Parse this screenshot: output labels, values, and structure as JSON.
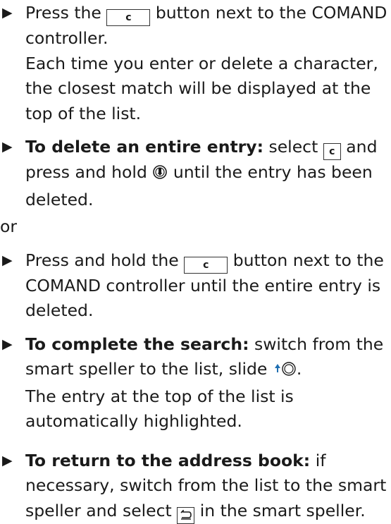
{
  "items": [
    {
      "prefix": "Press the",
      "key_label": "c",
      "suffix": "button next to the COMAND controller.",
      "note": "Each time you enter or delete a character, the closest match will be displayed at the top of the list."
    },
    {
      "bold": "To delete an entire entry:",
      "text_a": "select",
      "key_label": "c",
      "text_b": "and press and hold",
      "text_c": "until the entry has been deleted.",
      "icon": "press-controller-icon"
    },
    {
      "prefix": "Press and hold the",
      "key_label": "c",
      "suffix": "button next to the COMAND controller until the entire entry is deleted."
    },
    {
      "bold": "To complete the search:",
      "text_a": "switch from the smart speller to the list, slide",
      "icon": "slide-up-controller-icon",
      "note": "The entry at the top of the list is automatically highlighted."
    },
    {
      "bold": "To return to the address book:",
      "text_a": "if necessary, switch from the list to the smart speller and select",
      "icon": "back-key-icon",
      "text_b": "in the smart speller."
    }
  ],
  "or_text": "or",
  "bullet_glyph": "▶"
}
